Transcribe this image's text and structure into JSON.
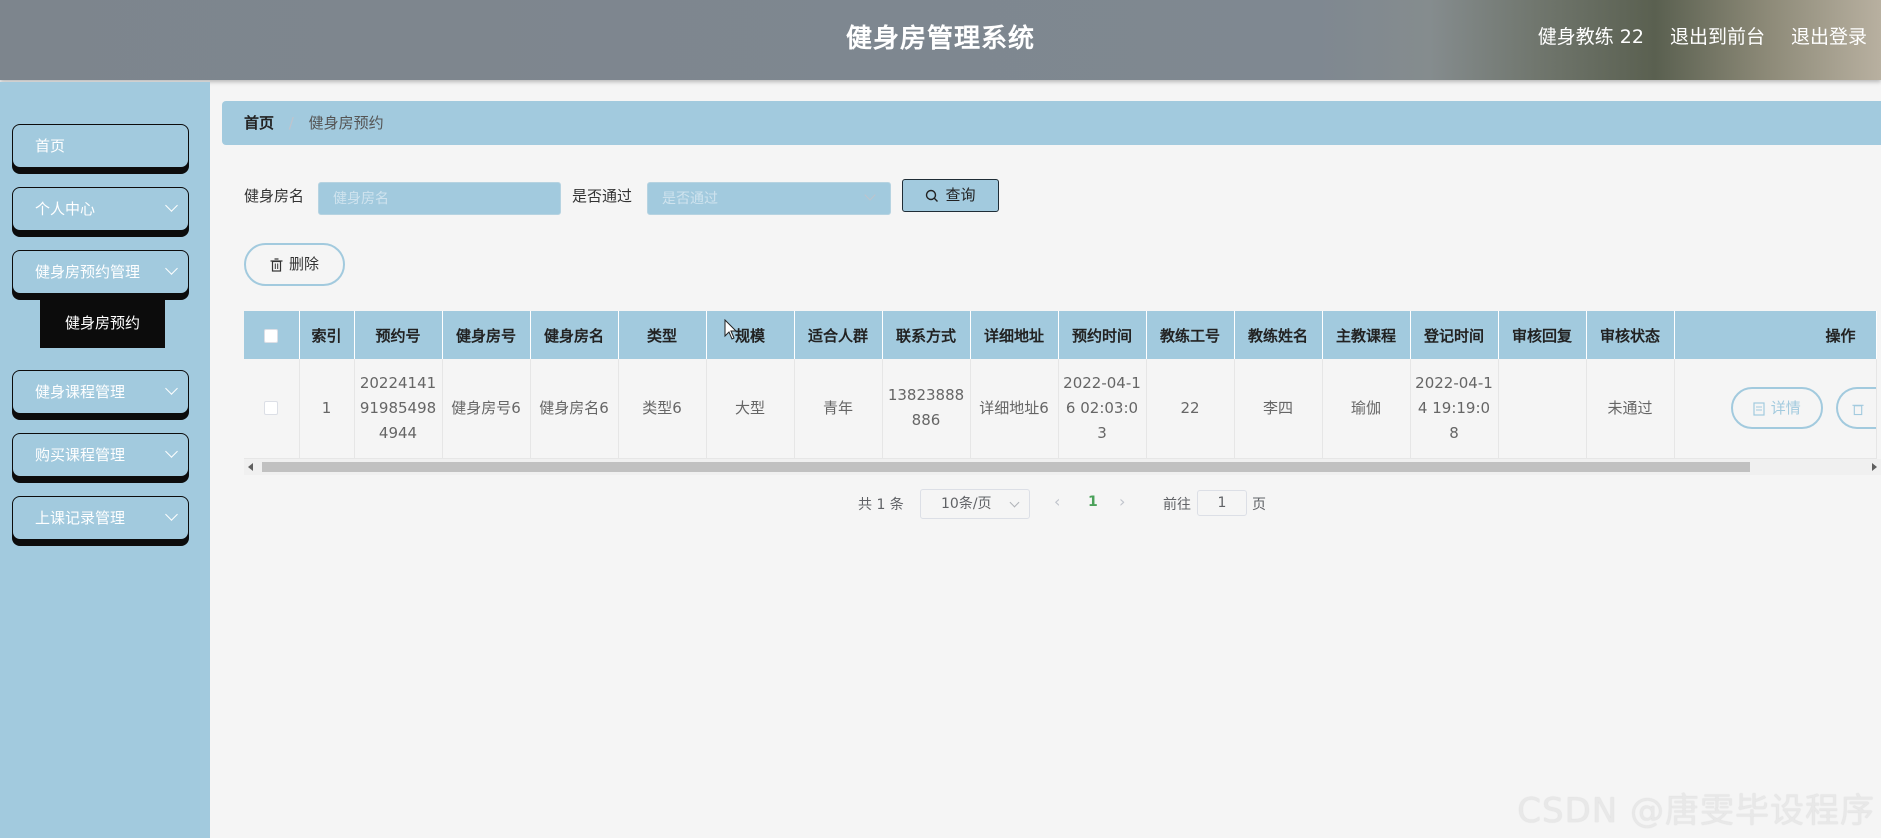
{
  "header": {
    "title": "健身房管理系统",
    "user": "健身教练 22",
    "back_to_front": "退出到前台",
    "logout": "退出登录"
  },
  "sidebar": {
    "items": [
      {
        "label": "首页",
        "has_arrow": false
      },
      {
        "label": "个人中心",
        "has_arrow": true
      },
      {
        "label": "健身房预约管理",
        "has_arrow": true
      },
      {
        "label": "健身课程管理",
        "has_arrow": true
      },
      {
        "label": "购买课程管理",
        "has_arrow": true
      },
      {
        "label": "上课记录管理",
        "has_arrow": true
      }
    ],
    "active_sub": "健身房预约"
  },
  "breadcrumb": {
    "home": "首页",
    "separator": "/",
    "current": "健身房预约"
  },
  "search": {
    "name_label": "健身房名",
    "name_placeholder": "健身房名",
    "pass_label": "是否通过",
    "pass_placeholder": "是否通过",
    "query_button": "查询"
  },
  "actions": {
    "delete_button": "删除"
  },
  "table": {
    "columns": [
      "",
      "索引",
      "预约号",
      "健身房号",
      "健身房名",
      "类型",
      "规模",
      "适合人群",
      "联系方式",
      "详细地址",
      "预约时间",
      "教练工号",
      "教练姓名",
      "主教课程",
      "登记时间",
      "审核回复",
      "审核状态",
      "操作"
    ],
    "rows": [
      {
        "index": "1",
        "order_no": "20224141919854984944",
        "gym_no": "健身房号6",
        "gym_name": "健身房名6",
        "type": "类型6",
        "scale": "大型",
        "audience": "青年",
        "contact": "13823888886",
        "address": "详细地址6",
        "book_time": "2022-04-16 02:03:03",
        "coach_no": "22",
        "coach_name": "李四",
        "course": "瑜伽",
        "reg_time": "2022-04-14 19:19:08",
        "reply": "",
        "status": "未通过",
        "detail_button": "详情"
      }
    ]
  },
  "pagination": {
    "total": "共 1 条",
    "page_size": "10条/页",
    "current_page": "1",
    "goto_label": "前往",
    "goto_value": "1",
    "page_suffix": "页"
  },
  "watermark": "CSDN @唐雯毕设程序",
  "colors": {
    "accent": "#a2cade",
    "dark": "#0c0c0c",
    "page_active": "#4ba15a"
  }
}
